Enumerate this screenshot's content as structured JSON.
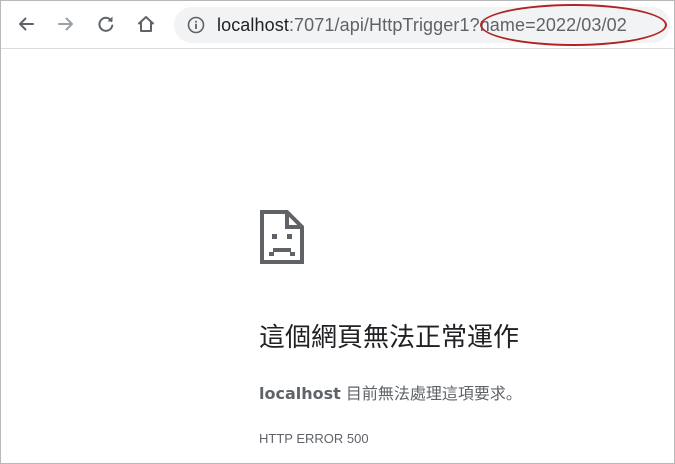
{
  "toolbar": {
    "back_icon": "arrow-left-icon",
    "forward_icon": "arrow-right-icon",
    "reload_icon": "reload-icon",
    "home_icon": "home-icon"
  },
  "omnibox": {
    "info_icon": "info-icon",
    "url_host": "localhost",
    "url_rest": ":7071/api/HttpTrigger1?name=2022/03/02"
  },
  "annotation": {
    "color": "#b22222"
  },
  "error_page": {
    "icon": "sad-page-icon",
    "title": "這個網頁無法正常運作",
    "desc_host": "localhost",
    "desc_text": " 目前無法處理這項要求。",
    "code": "HTTP ERROR 500"
  },
  "colors": {
    "text_primary": "#202124",
    "text_secondary": "#5f6368",
    "omnibox_bg": "#f1f3f4",
    "icon_disabled": "#9aa0a6"
  }
}
